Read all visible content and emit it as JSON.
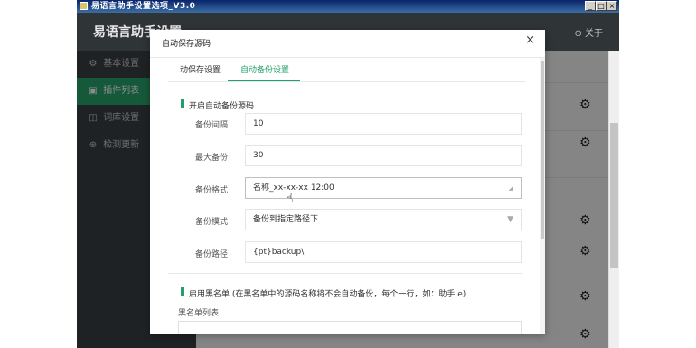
{
  "window": {
    "title": "易语言助手设置选项_V3.0",
    "min": "_",
    "max": "□",
    "close": "×"
  },
  "app": {
    "title": "易语言助手设置",
    "about": "⊙ 关于"
  },
  "sidebar": {
    "items": [
      {
        "icon": "⚙",
        "label": "基本设置"
      },
      {
        "icon": "▣",
        "label": "插件列表"
      },
      {
        "icon": "◫",
        "label": "词库设置"
      },
      {
        "icon": "⊕",
        "label": "检测更新"
      }
    ]
  },
  "content": {
    "gear": "⚙"
  },
  "dialog": {
    "title": "自动保存源码",
    "close": "×",
    "tabs": [
      {
        "label": "动保存设置"
      },
      {
        "label": "自动备份设置"
      }
    ],
    "section1": "开启自动备份源码",
    "fields": [
      {
        "label": "备份间隔",
        "value": "10"
      },
      {
        "label": "最大备份",
        "value": "30"
      },
      {
        "label": "备份格式",
        "value": "名称_xx-xx-xx 12:00"
      },
      {
        "label": "备份模式",
        "value": "备份到指定路径下"
      },
      {
        "label": "备份路径",
        "value": "{pt}backup\\"
      }
    ],
    "section2": "启用黑名单 (在黑名单中的源码名称将不会自动备份，每个一行，如：助手.e)",
    "list_label": "黑名单列表"
  },
  "colors": {
    "accent": "#21a06b",
    "header": "#2f3437",
    "sidebar": "#3a3f42"
  }
}
